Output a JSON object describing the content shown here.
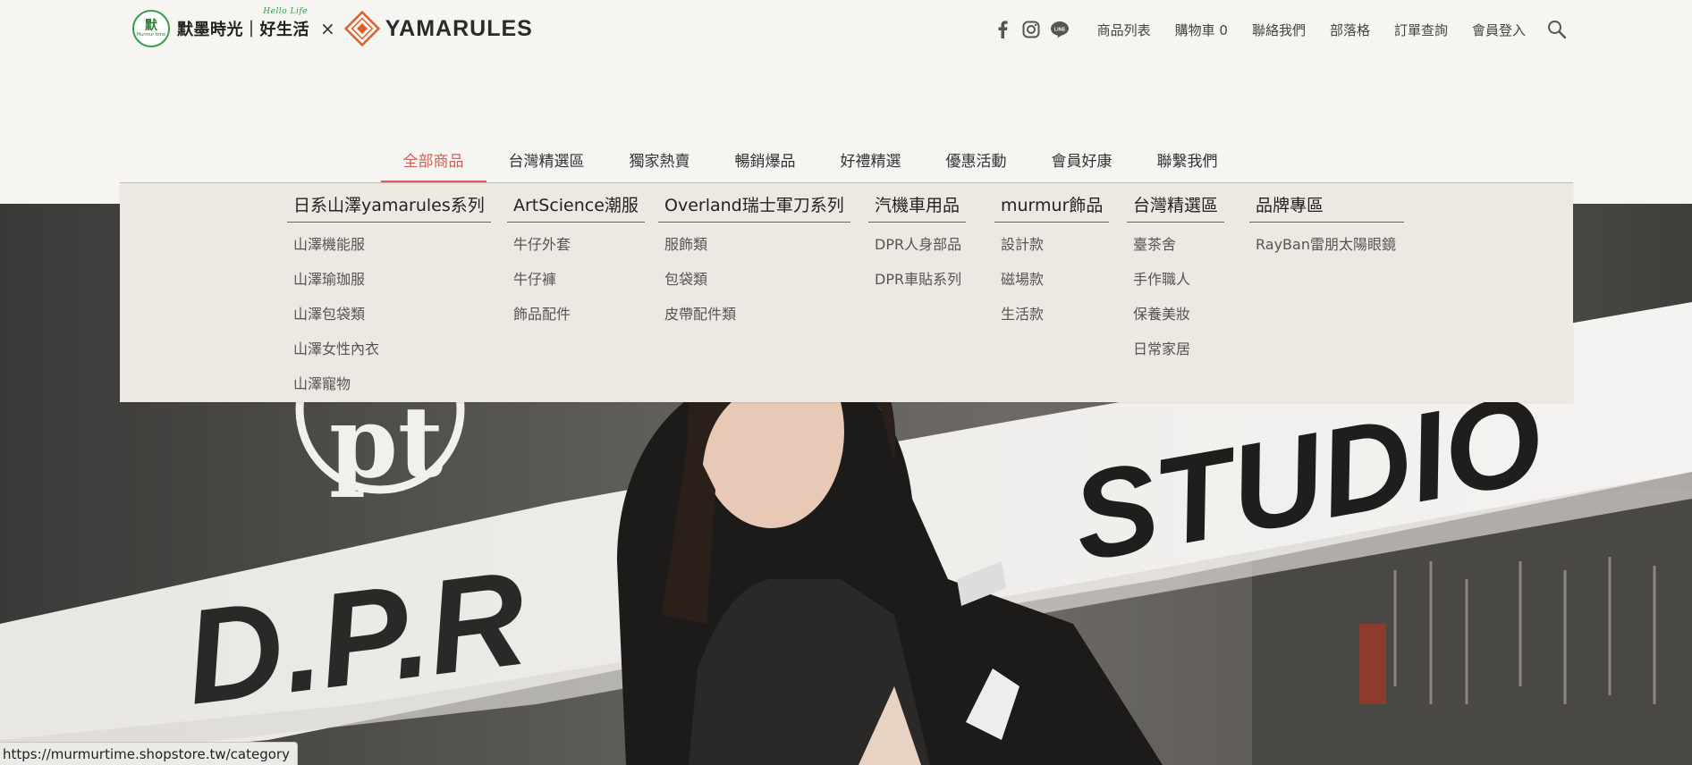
{
  "brand": {
    "logo_glyph": "默",
    "logo_tagline": "Murmur time",
    "name": "默墨時光｜好生活",
    "hello": "Hello Life",
    "separator": "×",
    "partner": "YAMARULES"
  },
  "topnav": {
    "social_icons": [
      "facebook-icon",
      "instagram-icon",
      "line-icon"
    ],
    "links": [
      "商品列表",
      "購物車 0",
      "聯絡我們",
      "部落格",
      "訂單查詢",
      "會員登入"
    ]
  },
  "mainnav": {
    "tabs": [
      "全部商品",
      "台灣精選區",
      "獨家熱賣",
      "暢銷爆品",
      "好禮精選",
      "優惠活動",
      "會員好康",
      "聯繫我們"
    ],
    "active_index": 0,
    "active_color": "#d0605a"
  },
  "dropdown": {
    "columns": [
      {
        "title": "日系山澤yamarules系列",
        "items": [
          "山澤機能服",
          "山澤瑜珈服",
          "山澤包袋類",
          "山澤女性內衣",
          "山澤寵物"
        ]
      },
      {
        "title": "ArtScience潮服",
        "items": [
          "牛仔外套",
          "牛仔褲",
          "飾品配件"
        ]
      },
      {
        "title": "Overland瑞士軍刀系列",
        "items": [
          "服飾類",
          "包袋類",
          "皮帶配件類"
        ]
      },
      {
        "title": "汽機車用品",
        "items": [
          "DPR人身部品",
          "DPR車貼系列"
        ]
      },
      {
        "title": "murmur飾品",
        "items": [
          "設計款",
          "磁場款",
          "生活款"
        ]
      },
      {
        "title": "台灣精選區",
        "items": [
          "臺茶舍",
          "手作職人",
          "保養美妝",
          "日常家居"
        ]
      },
      {
        "title": "品牌專區",
        "items": [
          "RayBan雷朋太陽眼鏡"
        ]
      }
    ]
  },
  "hero": {
    "text_left": "D.P.R",
    "text_right": "STUDIO",
    "logo_text": "pt"
  },
  "statusbar": {
    "url": "https://murmurtime.shopstore.tw/category"
  }
}
